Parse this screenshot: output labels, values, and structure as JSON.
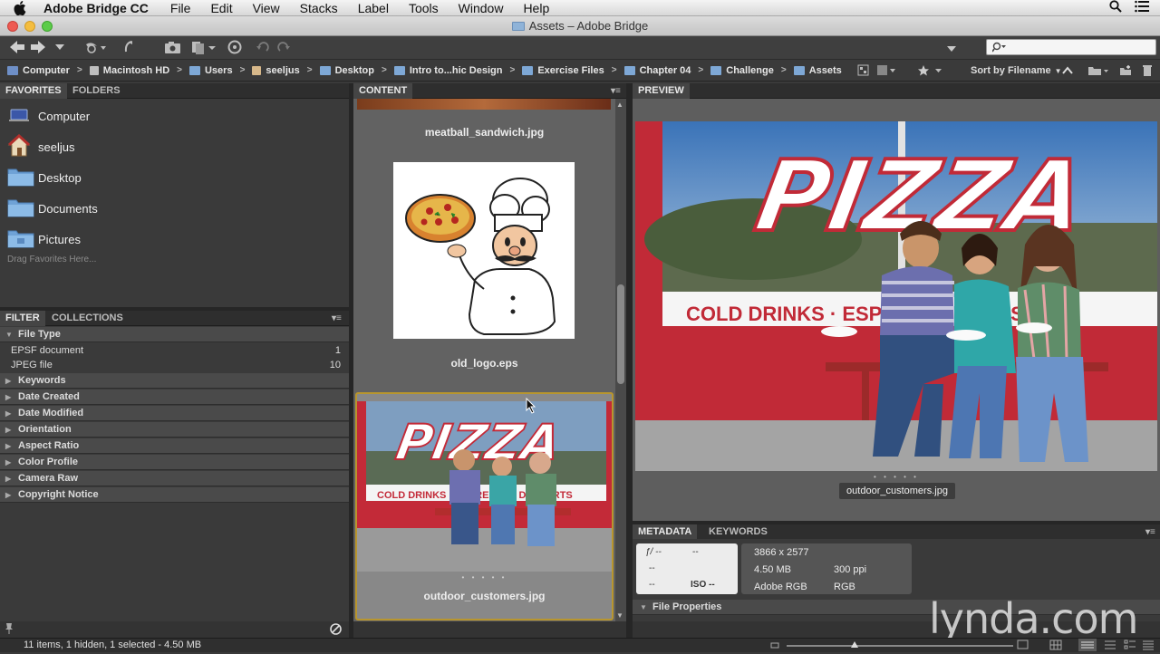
{
  "menubar": {
    "app_name": "Adobe Bridge CC",
    "items": [
      "File",
      "Edit",
      "View",
      "Stacks",
      "Label",
      "Tools",
      "Window",
      "Help"
    ]
  },
  "window": {
    "title": "Assets – Adobe Bridge"
  },
  "toolbar": {
    "search_placeholder": ""
  },
  "path": {
    "crumbs": [
      "Computer",
      "Macintosh HD",
      "Users",
      "seeljus",
      "Desktop",
      "Intro to...hic Design",
      "Exercise Files",
      "Chapter 04",
      "Challenge",
      "Assets"
    ],
    "sort_label": "Sort by Filename"
  },
  "favorites_panel": {
    "tabs": [
      "FAVORITES",
      "FOLDERS"
    ],
    "items": [
      "Computer",
      "seeljus",
      "Desktop",
      "Documents",
      "Pictures"
    ],
    "drag_hint": "Drag Favorites Here..."
  },
  "filter_panel": {
    "tabs": [
      "FILTER",
      "COLLECTIONS"
    ],
    "file_type_heading": "File Type",
    "file_types": [
      {
        "label": "EPSF document",
        "count": "1"
      },
      {
        "label": "JPEG file",
        "count": "10"
      }
    ],
    "categories": [
      "Keywords",
      "Date Created",
      "Date Modified",
      "Orientation",
      "Aspect Ratio",
      "Color Profile",
      "Camera Raw",
      "Copyright Notice"
    ]
  },
  "content_panel": {
    "tab": "CONTENT",
    "thumbnails": [
      {
        "filename": "meatball_sandwich.jpg"
      },
      {
        "filename": "old_logo.eps"
      },
      {
        "filename": "outdoor_customers.jpg",
        "selected": true
      }
    ]
  },
  "preview_panel": {
    "tab": "PREVIEW",
    "caption": "outdoor_customers.jpg",
    "sign_text": "PIZZA",
    "window_text": "COLD DRINKS · ESPRESSO · DESSERTS"
  },
  "metadata_panel": {
    "tabs": [
      "METADATA",
      "KEYWORDS"
    ],
    "camera": {
      "aperture": "ƒ/ --",
      "shutter": "--",
      "a": "--",
      "b": "--",
      "c": "--",
      "iso": "ISO --"
    },
    "dimensions": "3866 x 2577",
    "size": "4.50 MB",
    "resolution": "300 ppi",
    "profile": "Adobe RGB",
    "mode": "RGB",
    "section": "File Properties"
  },
  "statusbar": {
    "text": "11 items, 1 hidden, 1 selected - 4.50 MB"
  },
  "watermark": "lynda.com",
  "colors": {
    "panel_bg": "#3a3a3a",
    "content_bg": "#626262",
    "selection": "#b8962e",
    "pizza_red": "#c32a38"
  }
}
